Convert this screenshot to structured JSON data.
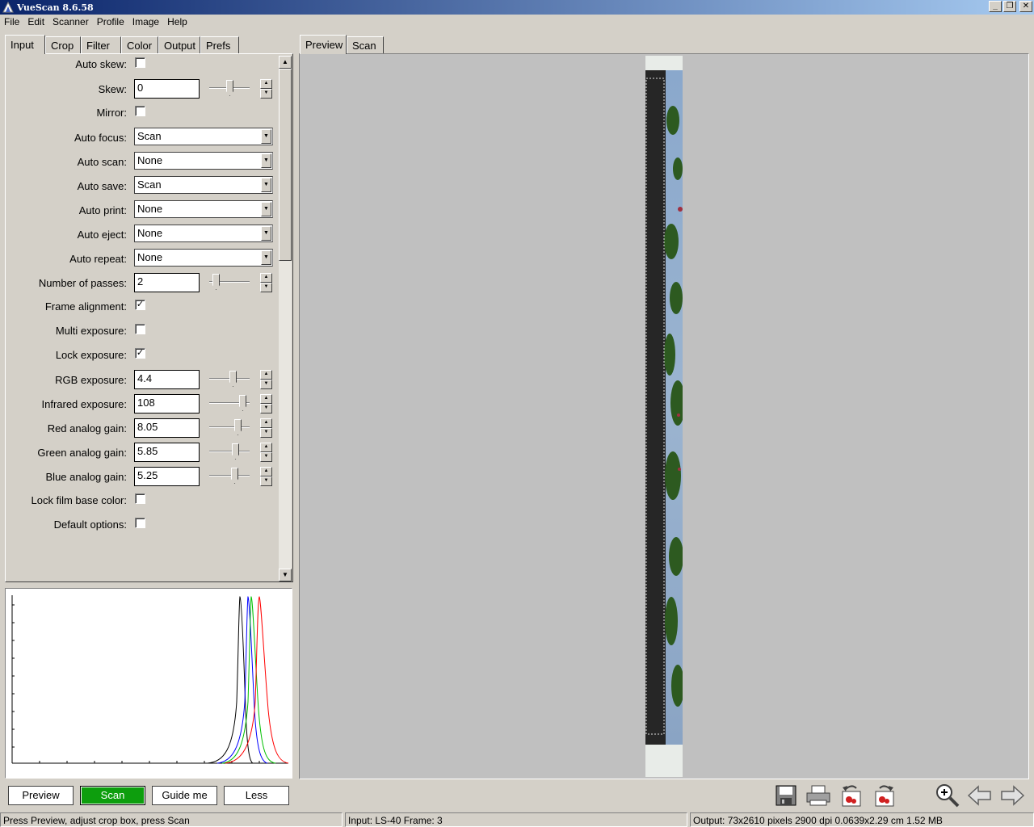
{
  "window": {
    "title": "VueScan 8.6.58",
    "buttons": {
      "minimize": "_",
      "maximize": "❐",
      "close": "✕"
    }
  },
  "menu": [
    "File",
    "Edit",
    "Scanner",
    "Profile",
    "Image",
    "Help"
  ],
  "left_tabs": [
    "Input",
    "Crop",
    "Filter",
    "Color",
    "Output",
    "Prefs"
  ],
  "right_tabs": [
    "Preview",
    "Scan"
  ],
  "options": {
    "auto_skew": {
      "label": "Auto skew:",
      "checked": false
    },
    "skew": {
      "label": "Skew:",
      "value": "0",
      "slider": 0.5
    },
    "mirror": {
      "label": "Mirror:",
      "checked": false
    },
    "auto_focus": {
      "label": "Auto focus:",
      "value": "Scan"
    },
    "auto_scan": {
      "label": "Auto scan:",
      "value": "None"
    },
    "auto_save": {
      "label": "Auto save:",
      "value": "Scan"
    },
    "auto_print": {
      "label": "Auto print:",
      "value": "None"
    },
    "auto_eject": {
      "label": "Auto eject:",
      "value": "None"
    },
    "auto_repeat": {
      "label": "Auto repeat:",
      "value": "None"
    },
    "number_of_passes": {
      "label": "Number of passes:",
      "value": "2",
      "slider": 0.1
    },
    "frame_alignment": {
      "label": "Frame alignment:",
      "checked": true
    },
    "multi_exposure": {
      "label": "Multi exposure:",
      "checked": false
    },
    "lock_exposure": {
      "label": "Lock exposure:",
      "checked": true
    },
    "rgb_exposure": {
      "label": "RGB exposure:",
      "value": "4.4",
      "slider": 0.62
    },
    "infrared_exposure": {
      "label": "Infrared exposure:",
      "value": "108",
      "slider": 0.9
    },
    "red_analog_gain": {
      "label": "Red analog gain:",
      "value": "8.05",
      "slider": 0.75
    },
    "green_analog_gain": {
      "label": "Green analog gain:",
      "value": "5.85",
      "slider": 0.68
    },
    "blue_analog_gain": {
      "label": "Blue analog gain:",
      "value": "5.25",
      "slider": 0.66
    },
    "lock_film_base_color": {
      "label": "Lock film base color:",
      "checked": false
    },
    "default_options": {
      "label": "Default options:",
      "checked": false
    }
  },
  "bottom_buttons": {
    "preview": "Preview",
    "scan": "Scan",
    "guide_me": "Guide me",
    "less": "Less"
  },
  "status": {
    "hint": "Press Preview, adjust crop box, press Scan",
    "input": "Input: LS-40 Frame: 3",
    "output": "Output: 73x2610 pixels 2900 dpi 0.0639x2.29 cm 1.52 MB"
  },
  "colors": {
    "scan_button": "#0d9e0d",
    "hist_red": "#ff0000",
    "hist_green": "#00c000",
    "hist_blue": "#0000ff",
    "hist_black": "#000000"
  },
  "toolbar_icons": [
    "save-icon",
    "print-icon",
    "rotate-left-icon",
    "rotate-right-icon",
    "zoom-in-icon",
    "previous-icon",
    "next-icon"
  ]
}
